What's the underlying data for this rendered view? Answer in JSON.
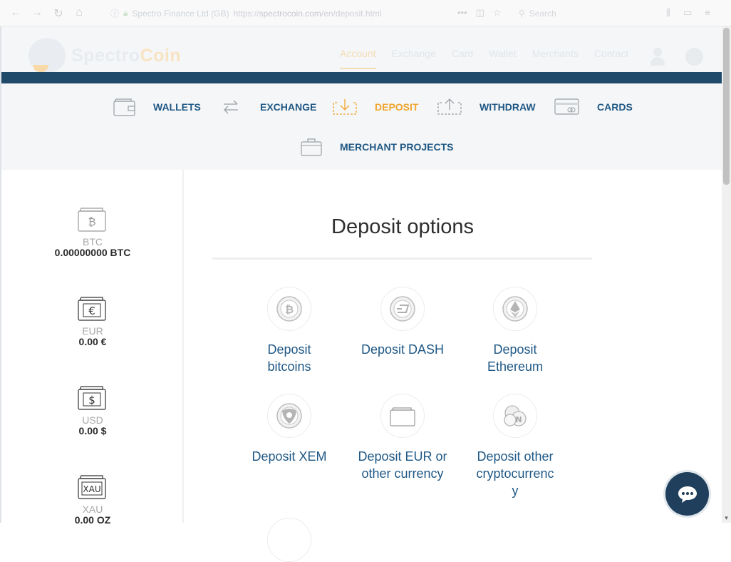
{
  "browser": {
    "site_name": "Spectro Finance Ltd (GB)",
    "url_prefix": "https://",
    "url_domain": "spectrocoin.com",
    "url_path": "/en/deposit.html",
    "search_placeholder": "Search",
    "more_glyph": "•••"
  },
  "header": {
    "logo_spectro": "Spectro",
    "logo_coin": "Coin",
    "menu": [
      {
        "label": "Account"
      },
      {
        "label": "Exchange"
      },
      {
        "label": "Card"
      },
      {
        "label": "Wallet"
      },
      {
        "label": "Merchants"
      },
      {
        "label": "Contact"
      }
    ]
  },
  "subnav": {
    "wallets": "WALLETS",
    "exchange": "EXCHANGE",
    "deposit": "DEPOSIT",
    "withdraw": "WITHDRAW",
    "cards": "CARDS",
    "merchant_projects": "MERCHANT PROJECTS"
  },
  "sidebar": {
    "wallets": [
      {
        "code": "BTC",
        "balance": "0.00000000 BTC",
        "icon": "bitcoin-wallet-icon",
        "glyph": "₿"
      },
      {
        "code": "EUR",
        "balance": "0.00 €",
        "icon": "euro-wallet-icon",
        "glyph": "€"
      },
      {
        "code": "USD",
        "balance": "0.00 $",
        "icon": "dollar-wallet-icon",
        "glyph": "$"
      },
      {
        "code": "XAU",
        "balance": "0.00 OZ",
        "icon": "gold-wallet-icon",
        "glyph": "XAU"
      }
    ]
  },
  "main": {
    "title": "Deposit options",
    "options": [
      {
        "label_line1": "Deposit",
        "label_line2": "bitcoins",
        "icon": "bitcoin-coin-icon"
      },
      {
        "label_line1": "Deposit DASH",
        "label_line2": "",
        "icon": "dash-coin-icon"
      },
      {
        "label_line1": "Deposit",
        "label_line2": "Ethereum",
        "icon": "ethereum-coin-icon"
      },
      {
        "label_line1": "Deposit XEM",
        "label_line2": "",
        "icon": "xem-coin-icon"
      },
      {
        "label_line1": "Deposit EUR or",
        "label_line2": "other currency",
        "icon": "wallet-icon"
      },
      {
        "label_line1": "Deposit other",
        "label_line2": "cryptocurrenc",
        "label_line3": "y",
        "icon": "other-crypto-coins-icon"
      }
    ]
  },
  "colors": {
    "accent": "#f0a530",
    "link": "#1f5885",
    "navy": "#1f4a6a",
    "chat": "#1f3f5c"
  }
}
